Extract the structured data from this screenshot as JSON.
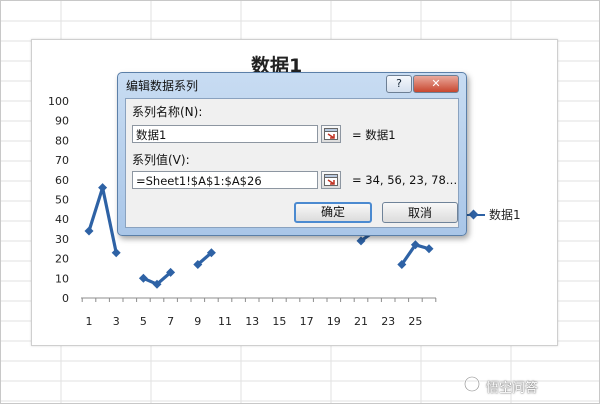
{
  "chart_data": {
    "type": "line",
    "title": "数据1",
    "x": [
      1,
      2,
      3,
      4,
      5,
      6,
      7,
      8,
      9,
      10,
      11,
      12,
      13,
      14,
      15,
      16,
      17,
      18,
      19,
      20,
      21,
      22,
      23,
      24,
      25,
      26
    ],
    "xticks": [
      "1",
      "3",
      "5",
      "7",
      "9",
      "11",
      "13",
      "15",
      "17",
      "19",
      "21",
      "23",
      "25"
    ],
    "yticks": [
      "100",
      "90",
      "80",
      "70",
      "60",
      "50",
      "40",
      "30",
      "20",
      "10",
      "0"
    ],
    "ylim": [
      0,
      100
    ],
    "series": [
      {
        "name": "数据1",
        "color": "#2e62a5",
        "values": [
          34,
          56,
          23,
          null,
          10,
          7,
          13,
          null,
          17,
          23,
          null,
          null,
          null,
          null,
          null,
          null,
          null,
          null,
          null,
          null,
          29,
          34,
          null,
          17,
          27,
          25
        ]
      }
    ],
    "legend": "right",
    "grid": false
  },
  "dialog": {
    "title": "编辑数据系列",
    "help_label": "?",
    "close_label": "✕",
    "name_label": "系列名称(N):",
    "name_value": "数据1",
    "name_preview": "= 数据1",
    "values_label": "系列值(V):",
    "values_value": "=Sheet1!$A$1:$A$26",
    "values_preview": "= 34, 56, 23, 78…",
    "ok_label": "确定",
    "cancel_label": "取消"
  },
  "watermark": "悟空问答",
  "colors": {
    "series": "#2e62a5",
    "dialog_frame": "#a9c6e8"
  }
}
